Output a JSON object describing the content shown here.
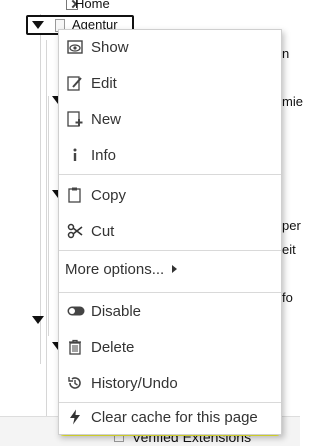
{
  "tree": {
    "home_label": "Home",
    "agentur_label": "Agentur",
    "fragments": {
      "n": "n",
      "mie": "mie",
      "per": "per",
      "eit": "eit",
      "fo": "fo",
      "verified": "Verified Extensions"
    }
  },
  "context_menu": {
    "items": [
      {
        "label": "Show",
        "icon": "eye-icon"
      },
      {
        "label": "Edit",
        "icon": "pencil-icon"
      },
      {
        "label": "New",
        "icon": "new-page-icon"
      },
      {
        "label": "Info",
        "icon": "info-icon"
      },
      {
        "label": "Copy",
        "icon": "clipboard-icon"
      },
      {
        "label": "Cut",
        "icon": "scissors-icon"
      },
      {
        "label": "Disable",
        "icon": "toggle-icon"
      },
      {
        "label": "Delete",
        "icon": "trash-icon"
      },
      {
        "label": "History/Undo",
        "icon": "history-icon"
      },
      {
        "label": "Clear cache for this page",
        "icon": "lightning-icon"
      }
    ],
    "more_options": "More options..."
  },
  "colors": {
    "highlight": "#ffff33",
    "menu_border": "#cfcfcf",
    "text": "#333333"
  }
}
